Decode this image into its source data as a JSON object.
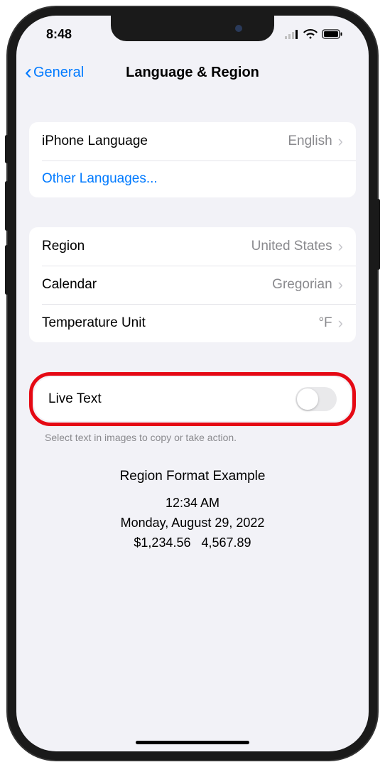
{
  "status": {
    "time": "8:48"
  },
  "nav": {
    "back_label": "General",
    "title": "Language & Region"
  },
  "group1": {
    "iphone_language_label": "iPhone Language",
    "iphone_language_value": "English",
    "other_languages_label": "Other Languages..."
  },
  "group2": {
    "region_label": "Region",
    "region_value": "United States",
    "calendar_label": "Calendar",
    "calendar_value": "Gregorian",
    "temp_label": "Temperature Unit",
    "temp_value": "°F"
  },
  "live_text": {
    "label": "Live Text",
    "footer": "Select text in images to copy or take action.",
    "enabled": false
  },
  "example": {
    "title": "Region Format Example",
    "time": "12:34 AM",
    "date": "Monday, August 29, 2022",
    "currency": "$1,234.56",
    "number": "4,567.89"
  }
}
